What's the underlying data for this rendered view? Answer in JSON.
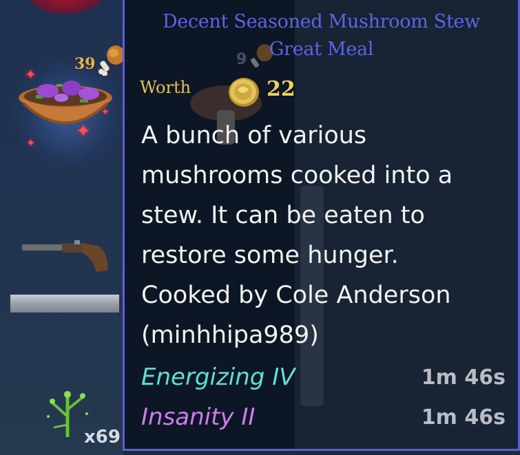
{
  "inventory": {
    "slot1_count": "39",
    "slot3_count": "x69",
    "icons": [
      "drumstick-icon",
      "mushroom-stew-bowl-icon",
      "sparkle-icon",
      "flintlock-pistol-icon",
      "metal-bar-icon",
      "herb-icon"
    ]
  },
  "tooltip": {
    "title_line1": "Decent Seasoned Mushroom Stew",
    "title_line2": "Great Meal",
    "worth_label": "Worth",
    "worth_value": "22",
    "description_lines": [
      "A bunch of various",
      "mushrooms cooked into a",
      "stew. It can be eaten to",
      "restore some hunger.",
      "Cooked by Cole Anderson",
      "(minhhipa989)"
    ],
    "effects": [
      {
        "name": "Energizing IV",
        "duration": "1m 46s",
        "color": "#5fe0d7"
      },
      {
        "name": "Insanity II",
        "duration": "1m 46s",
        "color": "#cf7cf0"
      }
    ],
    "background_count": "9",
    "colors": {
      "border": "#5d5fd6",
      "title": "#5c66e3",
      "worth": "#e2c35e",
      "description": "#f3f3f3",
      "duration": "#b9bcc4"
    }
  }
}
